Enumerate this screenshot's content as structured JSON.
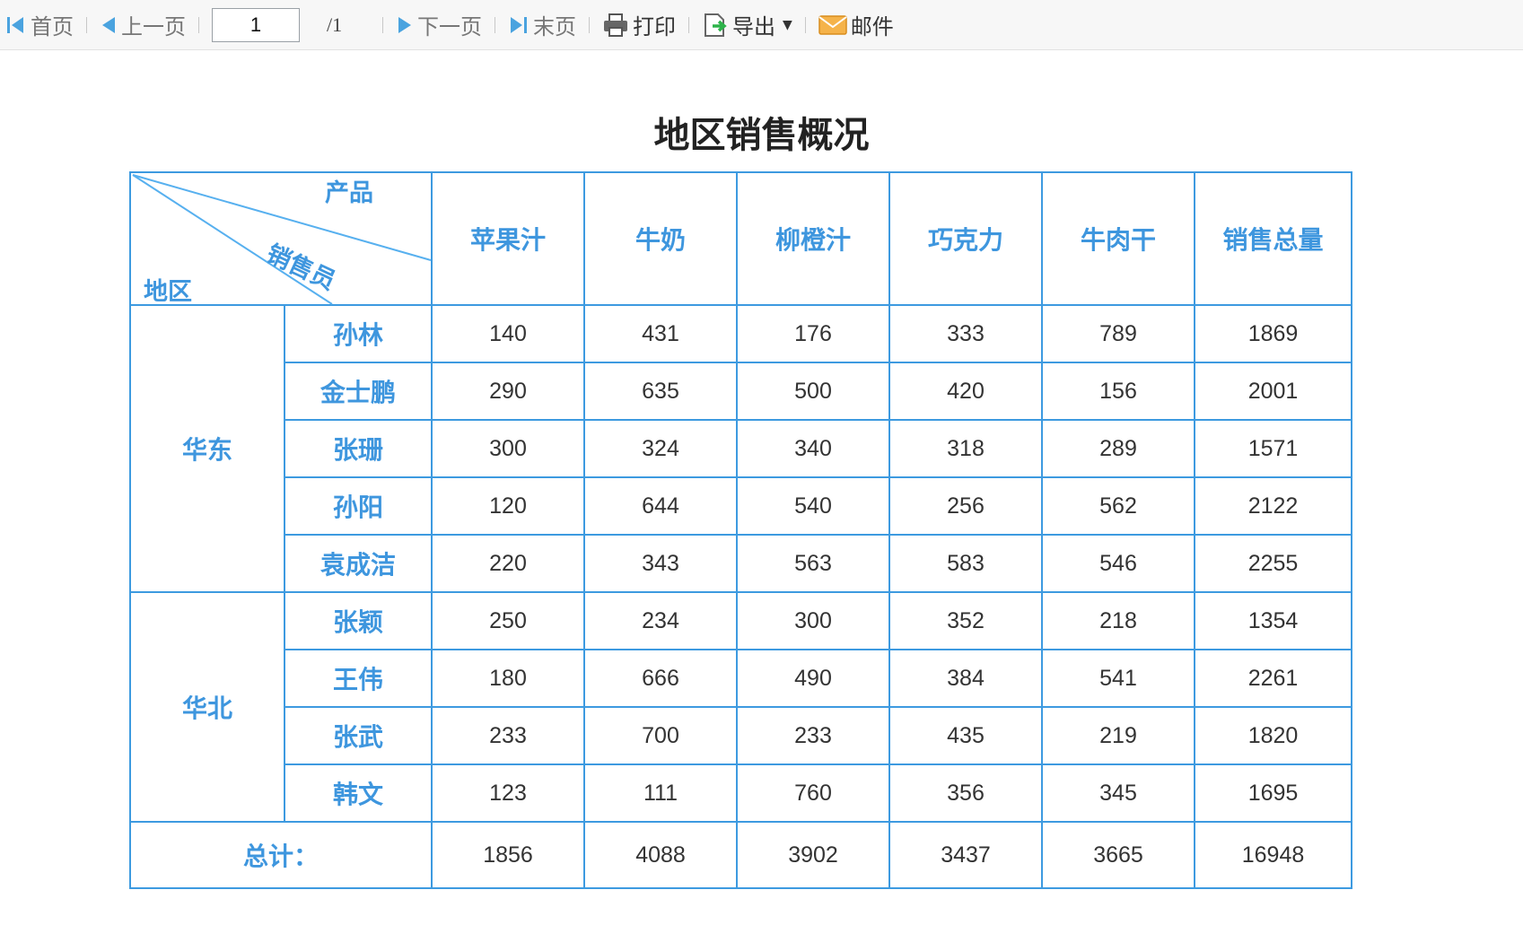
{
  "toolbar": {
    "first": "首页",
    "prev": "上一页",
    "page_value": "1",
    "page_total": "/1",
    "next": "下一页",
    "last": "末页",
    "print": "打印",
    "export": "导出",
    "mail": "邮件"
  },
  "report": {
    "title": "地区销售概况",
    "corner": {
      "product": "产品",
      "salesperson": "销售员",
      "region": "地区"
    },
    "columns": [
      "苹果汁",
      "牛奶",
      "柳橙汁",
      "巧克力",
      "牛肉干",
      "销售总量"
    ],
    "groups": [
      {
        "region": "华东",
        "rows": [
          {
            "name": "孙林",
            "values": [
              "140",
              "431",
              "176",
              "333",
              "789",
              "1869"
            ]
          },
          {
            "name": "金士鹏",
            "values": [
              "290",
              "635",
              "500",
              "420",
              "156",
              "2001"
            ]
          },
          {
            "name": "张珊",
            "values": [
              "300",
              "324",
              "340",
              "318",
              "289",
              "1571"
            ]
          },
          {
            "name": "孙阳",
            "values": [
              "120",
              "644",
              "540",
              "256",
              "562",
              "2122"
            ]
          },
          {
            "name": "袁成洁",
            "values": [
              "220",
              "343",
              "563",
              "583",
              "546",
              "2255"
            ]
          }
        ]
      },
      {
        "region": "华北",
        "rows": [
          {
            "name": "张颖",
            "values": [
              "250",
              "234",
              "300",
              "352",
              "218",
              "1354"
            ]
          },
          {
            "name": "王伟",
            "values": [
              "180",
              "666",
              "490",
              "384",
              "541",
              "2261"
            ]
          },
          {
            "name": "张武",
            "values": [
              "233",
              "700",
              "233",
              "435",
              "219",
              "1820"
            ]
          },
          {
            "name": "韩文",
            "values": [
              "123",
              "111",
              "760",
              "356",
              "345",
              "1695"
            ]
          }
        ]
      }
    ],
    "total": {
      "label": "总计：",
      "values": [
        "1856",
        "4088",
        "3902",
        "3437",
        "3665",
        "16948"
      ]
    }
  }
}
